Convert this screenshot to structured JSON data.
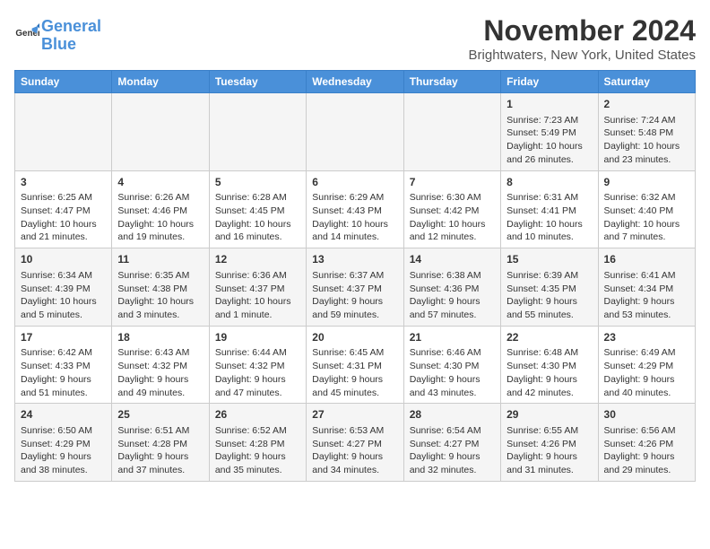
{
  "logo": {
    "text_general": "General",
    "text_blue": "Blue"
  },
  "title": "November 2024",
  "subtitle": "Brightwaters, New York, United States",
  "days_of_week": [
    "Sunday",
    "Monday",
    "Tuesday",
    "Wednesday",
    "Thursday",
    "Friday",
    "Saturday"
  ],
  "weeks": [
    [
      {
        "day": "",
        "content": ""
      },
      {
        "day": "",
        "content": ""
      },
      {
        "day": "",
        "content": ""
      },
      {
        "day": "",
        "content": ""
      },
      {
        "day": "",
        "content": ""
      },
      {
        "day": "1",
        "content": "Sunrise: 7:23 AM\nSunset: 5:49 PM\nDaylight: 10 hours and 26 minutes."
      },
      {
        "day": "2",
        "content": "Sunrise: 7:24 AM\nSunset: 5:48 PM\nDaylight: 10 hours and 23 minutes."
      }
    ],
    [
      {
        "day": "3",
        "content": "Sunrise: 6:25 AM\nSunset: 4:47 PM\nDaylight: 10 hours and 21 minutes."
      },
      {
        "day": "4",
        "content": "Sunrise: 6:26 AM\nSunset: 4:46 PM\nDaylight: 10 hours and 19 minutes."
      },
      {
        "day": "5",
        "content": "Sunrise: 6:28 AM\nSunset: 4:45 PM\nDaylight: 10 hours and 16 minutes."
      },
      {
        "day": "6",
        "content": "Sunrise: 6:29 AM\nSunset: 4:43 PM\nDaylight: 10 hours and 14 minutes."
      },
      {
        "day": "7",
        "content": "Sunrise: 6:30 AM\nSunset: 4:42 PM\nDaylight: 10 hours and 12 minutes."
      },
      {
        "day": "8",
        "content": "Sunrise: 6:31 AM\nSunset: 4:41 PM\nDaylight: 10 hours and 10 minutes."
      },
      {
        "day": "9",
        "content": "Sunrise: 6:32 AM\nSunset: 4:40 PM\nDaylight: 10 hours and 7 minutes."
      }
    ],
    [
      {
        "day": "10",
        "content": "Sunrise: 6:34 AM\nSunset: 4:39 PM\nDaylight: 10 hours and 5 minutes."
      },
      {
        "day": "11",
        "content": "Sunrise: 6:35 AM\nSunset: 4:38 PM\nDaylight: 10 hours and 3 minutes."
      },
      {
        "day": "12",
        "content": "Sunrise: 6:36 AM\nSunset: 4:37 PM\nDaylight: 10 hours and 1 minute."
      },
      {
        "day": "13",
        "content": "Sunrise: 6:37 AM\nSunset: 4:37 PM\nDaylight: 9 hours and 59 minutes."
      },
      {
        "day": "14",
        "content": "Sunrise: 6:38 AM\nSunset: 4:36 PM\nDaylight: 9 hours and 57 minutes."
      },
      {
        "day": "15",
        "content": "Sunrise: 6:39 AM\nSunset: 4:35 PM\nDaylight: 9 hours and 55 minutes."
      },
      {
        "day": "16",
        "content": "Sunrise: 6:41 AM\nSunset: 4:34 PM\nDaylight: 9 hours and 53 minutes."
      }
    ],
    [
      {
        "day": "17",
        "content": "Sunrise: 6:42 AM\nSunset: 4:33 PM\nDaylight: 9 hours and 51 minutes."
      },
      {
        "day": "18",
        "content": "Sunrise: 6:43 AM\nSunset: 4:32 PM\nDaylight: 9 hours and 49 minutes."
      },
      {
        "day": "19",
        "content": "Sunrise: 6:44 AM\nSunset: 4:32 PM\nDaylight: 9 hours and 47 minutes."
      },
      {
        "day": "20",
        "content": "Sunrise: 6:45 AM\nSunset: 4:31 PM\nDaylight: 9 hours and 45 minutes."
      },
      {
        "day": "21",
        "content": "Sunrise: 6:46 AM\nSunset: 4:30 PM\nDaylight: 9 hours and 43 minutes."
      },
      {
        "day": "22",
        "content": "Sunrise: 6:48 AM\nSunset: 4:30 PM\nDaylight: 9 hours and 42 minutes."
      },
      {
        "day": "23",
        "content": "Sunrise: 6:49 AM\nSunset: 4:29 PM\nDaylight: 9 hours and 40 minutes."
      }
    ],
    [
      {
        "day": "24",
        "content": "Sunrise: 6:50 AM\nSunset: 4:29 PM\nDaylight: 9 hours and 38 minutes."
      },
      {
        "day": "25",
        "content": "Sunrise: 6:51 AM\nSunset: 4:28 PM\nDaylight: 9 hours and 37 minutes."
      },
      {
        "day": "26",
        "content": "Sunrise: 6:52 AM\nSunset: 4:28 PM\nDaylight: 9 hours and 35 minutes."
      },
      {
        "day": "27",
        "content": "Sunrise: 6:53 AM\nSunset: 4:27 PM\nDaylight: 9 hours and 34 minutes."
      },
      {
        "day": "28",
        "content": "Sunrise: 6:54 AM\nSunset: 4:27 PM\nDaylight: 9 hours and 32 minutes."
      },
      {
        "day": "29",
        "content": "Sunrise: 6:55 AM\nSunset: 4:26 PM\nDaylight: 9 hours and 31 minutes."
      },
      {
        "day": "30",
        "content": "Sunrise: 6:56 AM\nSunset: 4:26 PM\nDaylight: 9 hours and 29 minutes."
      }
    ]
  ]
}
